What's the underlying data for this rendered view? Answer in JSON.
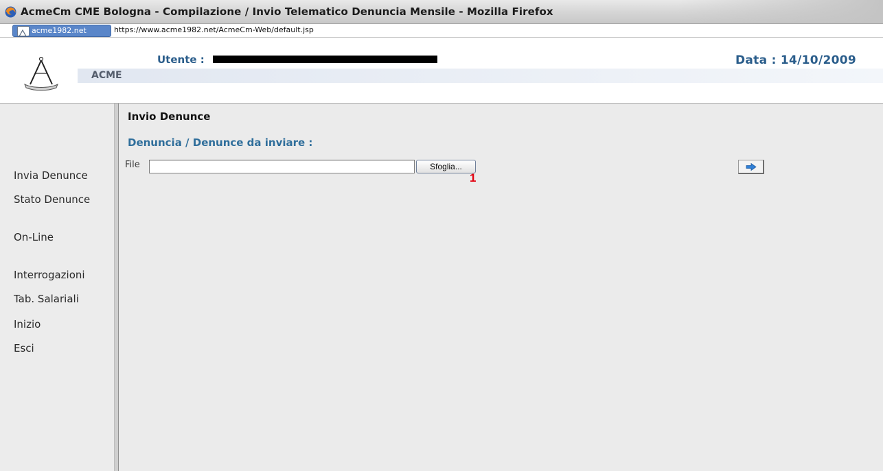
{
  "window": {
    "title": "AcmeCm CME Bologna - Compilazione / Invio Telematico Denuncia Mensile - Mozilla Firefox",
    "app_icon": "firefox-icon"
  },
  "addressbar": {
    "site_name": "acme1982.net",
    "url": "https://www.acme1982.net/AcmeCm-Web/default.jsp",
    "site_icon": "site-identity-icon"
  },
  "header": {
    "brand": "ACME",
    "logo_icon": "compass-logo-icon",
    "user_label": "Utente :",
    "user_value_redacted": true,
    "date_label": "Data : 14/10/2009"
  },
  "sidebar": {
    "items": [
      {
        "label": "Invia Denunce"
      },
      {
        "label": "Stato Denunce"
      },
      {
        "label": "On-Line"
      },
      {
        "label": "Interrogazioni"
      },
      {
        "label": "Tab. Salariali"
      },
      {
        "label": "Inizio"
      },
      {
        "label": "Esci"
      }
    ]
  },
  "main": {
    "title": "Invio Denunce",
    "subtitle": "Denuncia / Denunce da inviare :",
    "file_label": "File",
    "file_value": "",
    "browse_label": "Sfoglia...",
    "callout_number": "1",
    "send_icon": "arrow-right-icon"
  },
  "colors": {
    "heading_blue": "#2a5d8b",
    "subtitle_blue": "#2f6e9b",
    "callout_red": "#e3000f",
    "panel_bg": "#ebebeb"
  }
}
